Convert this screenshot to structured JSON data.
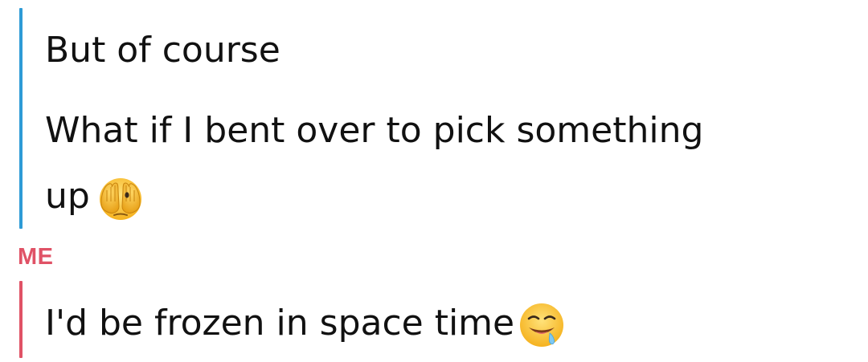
{
  "thread": {
    "them": {
      "color": "#2e9bd6",
      "messages": [
        {
          "text": "But of course"
        },
        {
          "text": "What if I bent over to pick something"
        },
        {
          "text": "up",
          "emoji": "peeking-face-icon"
        }
      ]
    },
    "me": {
      "label": "ME",
      "color": "#e05266",
      "messages": [
        {
          "text": "I'd be frozen in space time",
          "emoji": "drooling-face-icon"
        }
      ]
    }
  }
}
